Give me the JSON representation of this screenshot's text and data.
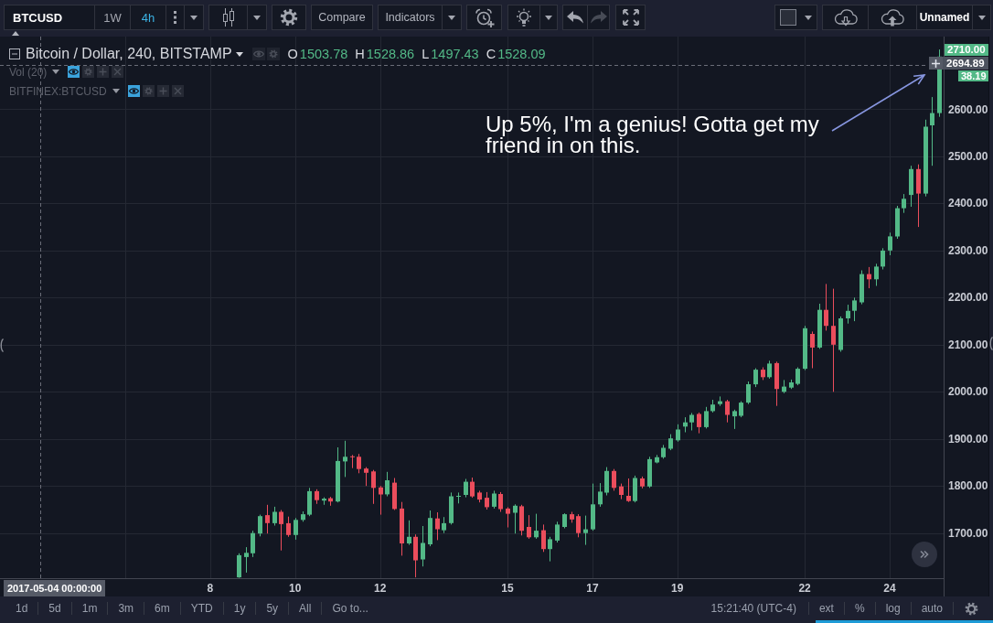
{
  "toolbar": {
    "symbol": "BTCUSD",
    "intervals": [
      {
        "label": "1W",
        "selected": false
      },
      {
        "label": "4h",
        "selected": true
      }
    ],
    "compare": "Compare",
    "indicators": "Indicators",
    "history": [
      {
        "kind": "undo",
        "disabled": false
      },
      {
        "kind": "redo",
        "disabled": true
      }
    ],
    "layout_name": "Unnamed"
  },
  "legend": {
    "title": "Bitcoin / Dollar, 240, BITSTAMP",
    "ohlc": [
      {
        "key": "O",
        "value": "1503.78"
      },
      {
        "key": "H",
        "value": "1528.86"
      },
      {
        "key": "L",
        "value": "1497.43"
      },
      {
        "key": "C",
        "value": "1528.09"
      }
    ],
    "studies": [
      {
        "name": "Vol (20)",
        "visible": true
      },
      {
        "name": "BITFINEX:BTCUSD",
        "visible": true
      }
    ]
  },
  "chart": {
    "chart_data": {
      "type": "candlestick",
      "x": [
        8.6667,
        8.8333,
        9,
        9.1667,
        9.3333,
        9.5,
        9.6667,
        9.8333,
        10,
        10.1667,
        10.3333,
        10.5,
        10.6667,
        10.8333,
        11,
        11.1667,
        11.3333,
        11.5,
        11.6667,
        11.8333,
        12,
        12.1667,
        12.3333,
        12.5,
        12.6667,
        12.8333,
        13,
        13.1667,
        13.3333,
        13.5,
        13.6667,
        13.8333,
        14,
        14.1667,
        14.3333,
        14.5,
        14.6667,
        14.8333,
        15,
        15.1667,
        15.3333,
        15.5,
        15.6667,
        15.8333,
        16,
        16.1667,
        16.3333,
        16.5,
        16.6667,
        16.8333,
        17,
        17.1667,
        17.3333,
        17.5,
        17.6667,
        17.8333,
        18,
        18.1667,
        18.3333,
        18.5,
        18.6667,
        18.8333,
        19,
        19.1667,
        19.3333,
        19.5,
        19.6667,
        19.8333,
        20,
        20.1667,
        20.3333,
        20.5,
        20.6667,
        20.8333,
        21,
        21.1667,
        21.3333,
        21.5,
        21.6667,
        21.8333,
        22,
        22.1667,
        22.3333,
        22.5,
        22.6667,
        22.8333,
        23,
        23.1667,
        23.3333,
        23.5,
        23.6667,
        23.8333,
        24,
        24.1667,
        24.3333,
        24.5,
        24.6667,
        24.8333,
        25,
        25.1667
      ],
      "ohlc": [
        [
          1606,
          1657,
          1605,
          1653
        ],
        [
          1649,
          1670,
          1616,
          1658
        ],
        [
          1657,
          1705,
          1649,
          1700
        ],
        [
          1699,
          1739,
          1693,
          1736
        ],
        [
          1738,
          1760,
          1699,
          1721
        ],
        [
          1721,
          1756,
          1716,
          1745
        ],
        [
          1745,
          1749,
          1663,
          1719
        ],
        [
          1721,
          1735,
          1692,
          1696
        ],
        [
          1696,
          1732,
          1686,
          1728
        ],
        [
          1728,
          1746,
          1724,
          1740
        ],
        [
          1739,
          1796,
          1736,
          1789
        ],
        [
          1789,
          1793,
          1762,
          1770
        ],
        [
          1769,
          1776,
          1760,
          1773
        ],
        [
          1774,
          1777,
          1758,
          1767
        ],
        [
          1767,
          1882,
          1765,
          1853
        ],
        [
          1852,
          1896,
          1819,
          1862
        ],
        [
          1863,
          1866,
          1838,
          1861
        ],
        [
          1862,
          1868,
          1827,
          1836
        ],
        [
          1837,
          1840,
          1800,
          1828
        ],
        [
          1831,
          1834,
          1762,
          1796
        ],
        [
          1797,
          1800,
          1739,
          1782
        ],
        [
          1782,
          1830,
          1778,
          1812
        ],
        [
          1807,
          1817,
          1749,
          1751
        ],
        [
          1752,
          1766,
          1652,
          1678
        ],
        [
          1678,
          1727,
          1675,
          1692
        ],
        [
          1692,
          1697,
          1606,
          1642
        ],
        [
          1644,
          1715,
          1629,
          1679
        ],
        [
          1676,
          1748,
          1672,
          1732
        ],
        [
          1731,
          1744,
          1685,
          1708
        ],
        [
          1706,
          1734,
          1700,
          1721
        ],
        [
          1721,
          1786,
          1718,
          1778
        ],
        [
          1778,
          1786,
          1763,
          1779
        ],
        [
          1781,
          1815,
          1776,
          1809
        ],
        [
          1809,
          1818,
          1775,
          1778
        ],
        [
          1786,
          1790,
          1765,
          1771
        ],
        [
          1775,
          1787,
          1750,
          1755
        ],
        [
          1756,
          1790,
          1752,
          1784
        ],
        [
          1783,
          1787,
          1745,
          1751
        ],
        [
          1752,
          1755,
          1712,
          1741
        ],
        [
          1743,
          1761,
          1699,
          1758
        ],
        [
          1757,
          1760,
          1695,
          1705
        ],
        [
          1713,
          1738,
          1688,
          1691
        ],
        [
          1691,
          1741,
          1688,
          1705
        ],
        [
          1706,
          1718,
          1660,
          1666
        ],
        [
          1666,
          1692,
          1640,
          1687
        ],
        [
          1684,
          1724,
          1680,
          1718
        ],
        [
          1713,
          1742,
          1710,
          1740
        ],
        [
          1740,
          1745,
          1722,
          1729
        ],
        [
          1736,
          1740,
          1691,
          1700
        ],
        [
          1700,
          1737,
          1675,
          1708
        ],
        [
          1708,
          1805,
          1705,
          1761
        ],
        [
          1761,
          1806,
          1756,
          1788
        ],
        [
          1786,
          1840,
          1780,
          1832
        ],
        [
          1832,
          1836,
          1790,
          1796
        ],
        [
          1799,
          1805,
          1772,
          1781
        ],
        [
          1779,
          1816,
          1766,
          1768
        ],
        [
          1768,
          1822,
          1765,
          1817
        ],
        [
          1816,
          1820,
          1795,
          1799
        ],
        [
          1799,
          1862,
          1796,
          1857
        ],
        [
          1850,
          1866,
          1848,
          1861
        ],
        [
          1861,
          1887,
          1858,
          1881
        ],
        [
          1879,
          1910,
          1876,
          1901
        ],
        [
          1897,
          1931,
          1894,
          1920
        ],
        [
          1926,
          1946,
          1914,
          1935
        ],
        [
          1935,
          1955,
          1918,
          1951
        ],
        [
          1953,
          1956,
          1912,
          1925
        ],
        [
          1925,
          1968,
          1922,
          1959
        ],
        [
          1959,
          1983,
          1956,
          1973
        ],
        [
          1974,
          1990,
          1970,
          1980
        ],
        [
          1980,
          1983,
          1935,
          1951
        ],
        [
          1948,
          1962,
          1921,
          1959
        ],
        [
          1949,
          1980,
          1946,
          1977
        ],
        [
          1977,
          2022,
          1974,
          2016
        ],
        [
          2016,
          2050,
          2010,
          2047
        ],
        [
          2047,
          2052,
          2025,
          2031
        ],
        [
          2031,
          2066,
          2028,
          2060
        ],
        [
          2061,
          2064,
          1970,
          2006
        ],
        [
          2000,
          2025,
          1997,
          2011
        ],
        [
          2009,
          2026,
          2006,
          2020
        ],
        [
          2017,
          2052,
          2014,
          2049
        ],
        [
          2049,
          2140,
          2046,
          2135
        ],
        [
          2123,
          2128,
          2050,
          2094
        ],
        [
          2094,
          2187,
          2091,
          2174
        ],
        [
          2174,
          2229,
          2130,
          2140
        ],
        [
          2140,
          2219,
          2000,
          2100
        ],
        [
          2089,
          2160,
          2085,
          2156
        ],
        [
          2156,
          2185,
          2145,
          2172
        ],
        [
          2172,
          2200,
          2150,
          2194
        ],
        [
          2190,
          2258,
          2186,
          2250
        ],
        [
          2250,
          2265,
          2220,
          2239
        ],
        [
          2239,
          2272,
          2225,
          2266
        ],
        [
          2266,
          2305,
          2260,
          2300
        ],
        [
          2300,
          2338,
          2290,
          2330
        ],
        [
          2330,
          2395,
          2325,
          2390
        ],
        [
          2390,
          2420,
          2380,
          2410
        ],
        [
          2418,
          2480,
          2393,
          2473
        ],
        [
          2473,
          2483,
          2350,
          2421
        ],
        [
          2421,
          2578,
          2415,
          2563
        ],
        [
          2566,
          2626,
          2480,
          2592
        ],
        [
          2592,
          2727,
          2584,
          2712
        ]
      ],
      "xlim": [
        3.05,
        25.27
      ],
      "ylim": [
        1604.2,
        2754.4
      ],
      "xticks": [
        8,
        10,
        12,
        15,
        17,
        19,
        22,
        24
      ],
      "yticks": [
        {
          "value": 2600,
          "label": "2600.00"
        },
        {
          "value": 2500,
          "label": "2500.00"
        },
        {
          "value": 2400,
          "label": "2400.00"
        },
        {
          "value": 2300,
          "label": "2300.00"
        },
        {
          "value": 2200,
          "label": "2200.00"
        },
        {
          "value": 2100,
          "label": "2100.00"
        },
        {
          "value": 2000,
          "label": "2000.00"
        },
        {
          "value": 1900,
          "label": "1900.00"
        },
        {
          "value": 1800,
          "label": "1800.00"
        },
        {
          "value": 1700,
          "label": "1700.00"
        }
      ],
      "grid": true,
      "ref_lines": [
        {
          "axis": "y",
          "value": 2694.89
        },
        {
          "axis": "x",
          "value": 4
        }
      ]
    },
    "annotation": "Up 5%, I'm a genius! Gotta get my friend in on this.",
    "last_price": "2710.00",
    "crosshair_price": "2694.89",
    "secondary_price_label": "38.19",
    "crosshair_time": "2017-05-04 00:00:00"
  },
  "bottom_bar": {
    "ranges": [
      "1d",
      "5d",
      "1m",
      "3m",
      "6m",
      "YTD",
      "1y",
      "5y",
      "All"
    ],
    "goto": "Go to...",
    "clock": "15:21:40 (UTC-4)",
    "scale_options": [
      "ext",
      "%",
      "log",
      "auto"
    ]
  }
}
